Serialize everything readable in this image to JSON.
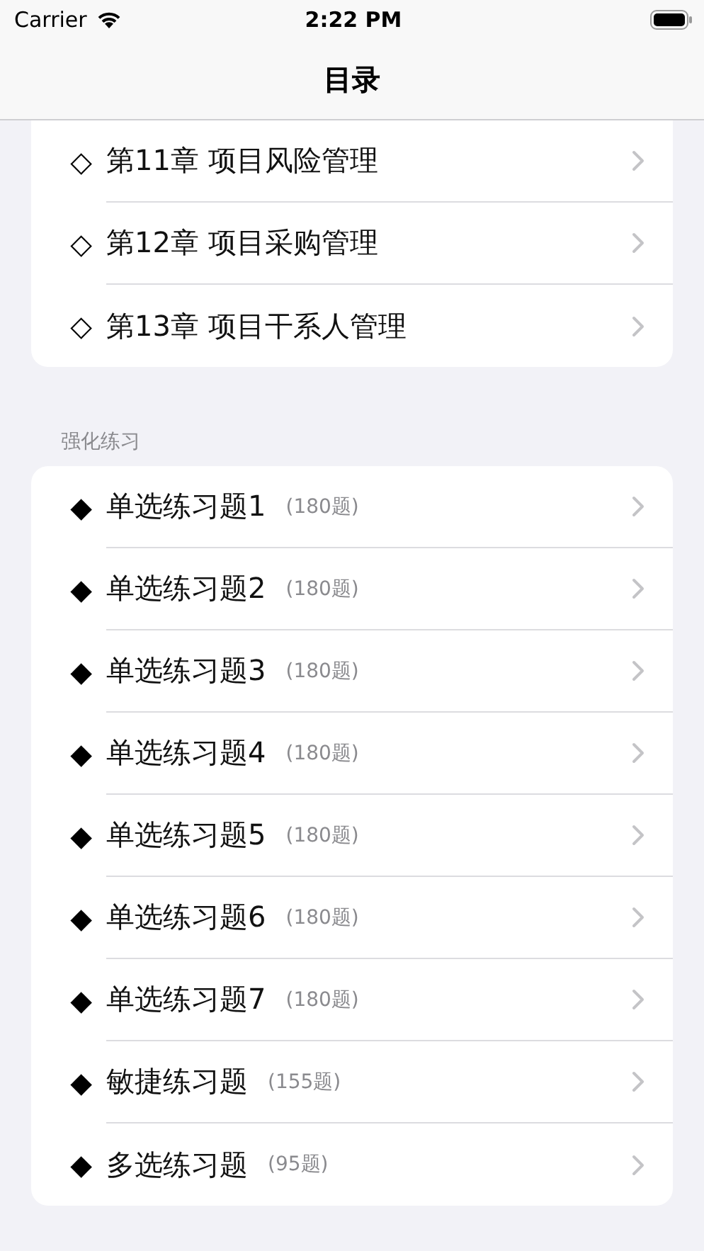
{
  "status_bar": {
    "carrier": "Carrier",
    "time": "2:22 PM"
  },
  "nav": {
    "title": "目录"
  },
  "sections": [
    {
      "items": [
        {
          "marker": "◇",
          "label": "第11章 项目风险管理"
        },
        {
          "marker": "◇",
          "label": "第12章 项目采购管理"
        },
        {
          "marker": "◇",
          "label": "第13章 项目干系人管理"
        }
      ]
    },
    {
      "header": "强化练习",
      "items": [
        {
          "marker": "◆",
          "label": "单选练习题1",
          "count": "(180题)"
        },
        {
          "marker": "◆",
          "label": "单选练习题2",
          "count": "(180题)"
        },
        {
          "marker": "◆",
          "label": "单选练习题3",
          "count": "(180题)"
        },
        {
          "marker": "◆",
          "label": "单选练习题4",
          "count": "(180题)"
        },
        {
          "marker": "◆",
          "label": "单选练习题5",
          "count": "(180题)"
        },
        {
          "marker": "◆",
          "label": "单选练习题6",
          "count": "(180题)"
        },
        {
          "marker": "◆",
          "label": "单选练习题7",
          "count": "(180题)"
        },
        {
          "marker": "◆",
          "label": "敏捷练习题",
          "count": "(155题)"
        },
        {
          "marker": "◆",
          "label": "多选练习题",
          "count": "(95题)"
        }
      ]
    }
  ]
}
